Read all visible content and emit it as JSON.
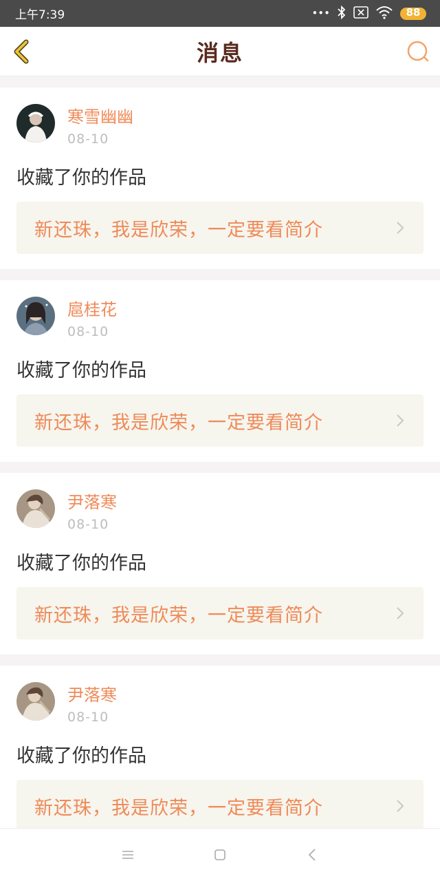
{
  "status_bar": {
    "time": "上午7:39",
    "signal_dots": "•••",
    "battery": "88"
  },
  "header": {
    "title": "消息"
  },
  "messages": [
    {
      "username": "寒雪幽幽",
      "date": "08-10",
      "action": "收藏了你的作品",
      "work_title": "新还珠，我是欣荣，一定要看简介"
    },
    {
      "username": "扈桂花",
      "date": "08-10",
      "action": "收藏了你的作品",
      "work_title": "新还珠，我是欣荣，一定要看简介"
    },
    {
      "username": "尹落寒",
      "date": "08-10",
      "action": "收藏了你的作品",
      "work_title": "新还珠，我是欣荣，一定要看简介"
    },
    {
      "username": "尹落寒",
      "date": "08-10",
      "action": "收藏了你的作品",
      "work_title": "新还珠，我是欣荣，一定要看简介"
    }
  ],
  "colors": {
    "accent": "#ef8a58",
    "title": "#5a2a1e",
    "back_icon": "#e8c43a"
  }
}
